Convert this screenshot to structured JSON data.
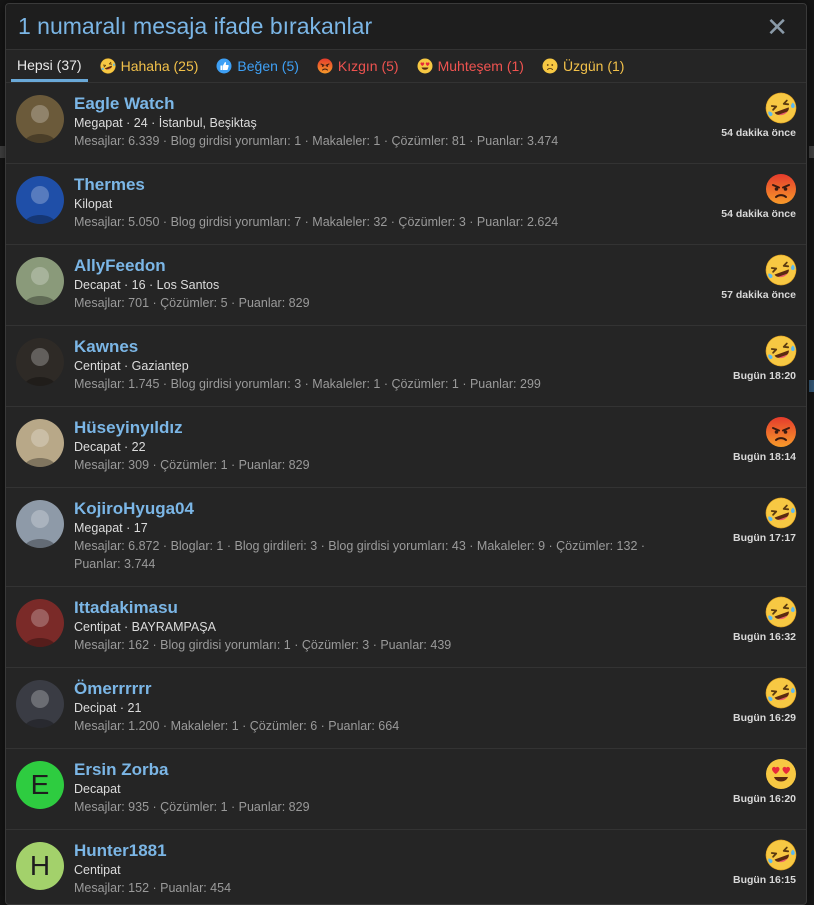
{
  "dialog": {
    "title": "1 numaralı mesaja ifade bırakanlar",
    "close_glyph": "✕"
  },
  "tabs": [
    {
      "label": "Hepsi (37)",
      "icon": "",
      "color": "#e8e8e8"
    },
    {
      "label": "Hahaha (25)",
      "icon": "haha",
      "color": "#f2c14a"
    },
    {
      "label": "Beğen (5)",
      "icon": "like",
      "color": "#3ea0f5"
    },
    {
      "label": "Kızgın (5)",
      "icon": "angry",
      "color": "#ef5350"
    },
    {
      "label": "Muhteşem (1)",
      "icon": "love",
      "color": "#ef5350"
    },
    {
      "label": "Üzgün (1)",
      "icon": "sad",
      "color": "#f2c14a"
    }
  ],
  "users": [
    {
      "name": "Eagle Watch",
      "meta": "Megapat · 24 · İstanbul, Beşiktaş",
      "stats": "Mesajlar: 6.339 · Blog girdisi yorumları: 1 · Makaleler: 1 · Çözümler: 81 · Puanlar: 3.474",
      "reaction": "haha",
      "time": "54 dakika önce",
      "avatar": "photo",
      "avatar_color": "#6b5a3a"
    },
    {
      "name": "Thermes",
      "meta": "Kilopat",
      "stats": "Mesajlar: 5.050 · Blog girdisi yorumları: 7 · Makaleler: 32 · Çözümler: 3 · Puanlar: 2.624",
      "reaction": "angry",
      "time": "54 dakika önce",
      "avatar": "photo",
      "avatar_color": "#1f4fa8"
    },
    {
      "name": "AllyFeedon",
      "meta": "Decapat · 16 · Los Santos",
      "stats": "Mesajlar: 701 · Çözümler: 5 · Puanlar: 829",
      "reaction": "haha",
      "time": "57 dakika önce",
      "avatar": "photo",
      "avatar_color": "#8a9a7a"
    },
    {
      "name": "Kawnes",
      "meta": "Centipat · Gaziantep",
      "stats": "Mesajlar: 1.745 · Blog girdisi yorumları: 3 · Makaleler: 1 · Çözümler: 1 · Puanlar: 299",
      "reaction": "haha",
      "time": "Bugün 18:20",
      "avatar": "photo",
      "avatar_color": "#2e2a26"
    },
    {
      "name": "Hüseyinyıldız",
      "meta": "Decapat · 22",
      "stats": "Mesajlar: 309 · Çözümler: 1 · Puanlar: 829",
      "reaction": "angry",
      "time": "Bugün 18:14",
      "avatar": "photo",
      "avatar_color": "#b8a888"
    },
    {
      "name": "KojiroHyuga04",
      "meta": "Megapat · 17",
      "stats": "Mesajlar: 6.872 · Bloglar: 1 · Blog girdileri: 3 · Blog girdisi yorumları: 43 · Makaleler: 9 · Çözümler: 132 · Puanlar: 3.744",
      "reaction": "haha",
      "time": "Bugün 17:17",
      "avatar": "photo",
      "avatar_color": "#8e9aa8"
    },
    {
      "name": "Ittadakimasu",
      "meta": "Centipat · BAYRAMPAŞA",
      "stats": "Mesajlar: 162 · Blog girdisi yorumları: 1 · Çözümler: 3 · Puanlar: 439",
      "reaction": "haha",
      "time": "Bugün 16:32",
      "avatar": "photo",
      "avatar_color": "#7a2a28"
    },
    {
      "name": "Ömerrrrrr",
      "meta": "Decipat · 21",
      "stats": "Mesajlar: 1.200 · Makaleler: 1 · Çözümler: 6 · Puanlar: 664",
      "reaction": "haha",
      "time": "Bugün 16:29",
      "avatar": "photo",
      "avatar_color": "#3a3c44"
    },
    {
      "name": "Ersin Zorba",
      "meta": "Decapat",
      "stats": "Mesajlar: 935 · Çözümler: 1 · Puanlar: 829",
      "reaction": "love",
      "time": "Bugün 16:20",
      "avatar": "E",
      "avatar_color": "#2ecc40"
    },
    {
      "name": "Hunter1881",
      "meta": "Centipat",
      "stats": "Mesajlar: 152 · Puanlar: 454",
      "reaction": "haha",
      "time": "Bugün 16:15",
      "avatar": "H",
      "avatar_color": "#a3d16b"
    }
  ]
}
